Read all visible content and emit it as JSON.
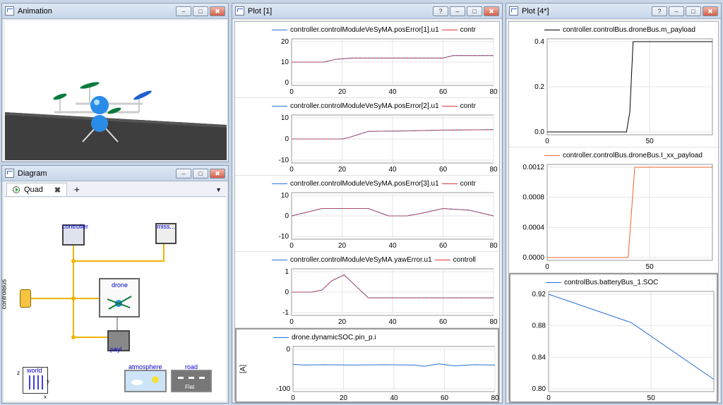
{
  "animation": {
    "title": "Animation"
  },
  "diagram": {
    "title": "Diagram",
    "tab_label": "Quad",
    "tab_close": "✖",
    "tab_add": "+",
    "tab_menu": "▼",
    "blocks": {
      "controller": "controller",
      "miss": "miss...",
      "drone": "drone",
      "payl": "payl",
      "controlBus": "controlBus",
      "world": "world",
      "atmosphere": "atmosphere",
      "road": "road",
      "road_sub": "Flat",
      "axis_z": "z",
      "axis_y": "y",
      "axis_x": "x"
    }
  },
  "plot1": {
    "title": "Plot [1]",
    "window_buttons": [
      "?",
      "‒",
      "□",
      "✖"
    ],
    "panels": [
      {
        "legend": [
          "controller.controlModuleVeSyMA.posError[1].u1",
          "contr"
        ],
        "xticks": [
          "0",
          "20",
          "40",
          "60",
          "80"
        ],
        "yticks": [
          "20",
          "10",
          "0"
        ],
        "ylabel": ""
      },
      {
        "legend": [
          "controller.controlModuleVeSyMA.posError[2].u1",
          "contr"
        ],
        "xticks": [
          "0",
          "20",
          "40",
          "60",
          "80"
        ],
        "yticks": [
          "10",
          "0",
          "-10"
        ],
        "ylabel": ""
      },
      {
        "legend": [
          "controller.controlModuleVeSyMA.posError[3].u1",
          "contr"
        ],
        "xticks": [
          "0",
          "20",
          "40",
          "60",
          "80"
        ],
        "yticks": [
          "10",
          "0",
          "-10"
        ],
        "ylabel": ""
      },
      {
        "legend": [
          "controller.controlModuleVeSyMA.yawError.u1",
          "controll"
        ],
        "xticks": [
          "0",
          "20",
          "40",
          "60",
          "80"
        ],
        "yticks": [
          "1",
          "0",
          "-1"
        ],
        "ylabel": ""
      },
      {
        "legend": [
          "drone.dynamicSOC.pin_p.i"
        ],
        "xticks": [
          "0",
          "20",
          "40",
          "60",
          "80"
        ],
        "yticks": [
          "0",
          "-100"
        ],
        "ylabel": "[A]"
      }
    ]
  },
  "plot4": {
    "title": "Plot [4*]",
    "window_buttons": [
      "?",
      "‒",
      "□",
      "✖"
    ],
    "panels": [
      {
        "legend": [
          "controller.controlBus.droneBus.m_payload"
        ],
        "xticks": [
          "0",
          "50"
        ],
        "yticks": [
          "0.4",
          "0.2",
          "0.0"
        ],
        "ylabel": ""
      },
      {
        "legend": [
          "controller.controlBus.droneBus.I_xx_payload"
        ],
        "xticks": [
          "0",
          "50"
        ],
        "yticks": [
          "0.0012",
          "0.0008",
          "0.0004",
          "0.0000"
        ],
        "ylabel": ""
      },
      {
        "legend": [
          "controlBus.batteryBus_1.SOC"
        ],
        "xticks": [
          "0",
          "50"
        ],
        "yticks": [
          "0.92",
          "0.88",
          "0.84",
          "0.80"
        ],
        "ylabel": ""
      }
    ]
  },
  "window_controls": [
    "‒",
    "□",
    "✖"
  ],
  "colors": {
    "blue": "#2a6fd6",
    "red": "#e0393b",
    "black": "#000000",
    "orange": "#e8652b",
    "connector": "#f0b400"
  }
}
